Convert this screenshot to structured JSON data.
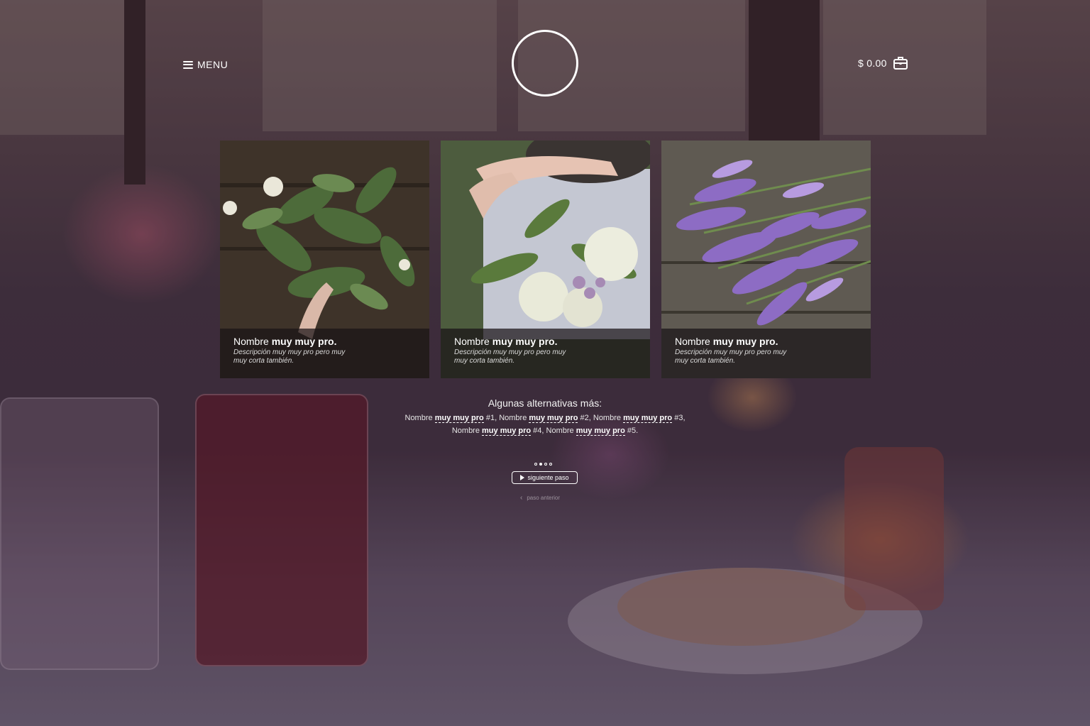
{
  "header": {
    "menu_label": "MENU",
    "cart_amount": "$ 0.00"
  },
  "cards": [
    {
      "name_regular": "Nombre ",
      "name_bold": "muy muy pro.",
      "description": "Descripción muy muy pro pero muy muy corta también.",
      "image": "green-foliage-bouquet"
    },
    {
      "name_regular": "Nombre ",
      "name_bold": "muy muy pro.",
      "description": "Descripción muy muy pro pero muy muy corta también.",
      "image": "bridal-roses-bouquet"
    },
    {
      "name_regular": "Nombre ",
      "name_bold": "muy muy pro.",
      "description": "Descripción muy muy pro pero muy muy corta también.",
      "image": "lavender-bunch"
    }
  ],
  "alternatives": {
    "title": "Algunas alternativas más:",
    "items": [
      {
        "prefix": "Nombre ",
        "bold": "muy muy pro",
        "suffix": " #1"
      },
      {
        "prefix": "Nombre ",
        "bold": "muy muy pro",
        "suffix": " #2"
      },
      {
        "prefix": "Nombre ",
        "bold": "muy muy pro",
        "suffix": " #3"
      },
      {
        "prefix": "Nombre ",
        "bold": "muy muy pro",
        "suffix": " #4"
      },
      {
        "prefix": "Nombre ",
        "bold": "muy muy pro",
        "suffix": " #5"
      }
    ],
    "sep1": ", ",
    "sep2": ", ",
    "sep3": ",",
    "sep4": ", ",
    "end": "."
  },
  "pagination": {
    "total": 4,
    "active_index": 1
  },
  "buttons": {
    "next_label": "siguiente paso",
    "prev_label": "paso anterior"
  },
  "colors": {
    "overlay": "#46284640",
    "caption_bg": "#191416",
    "text": "#ffffff"
  },
  "icons": {
    "menu": "hamburger-icon",
    "cart": "briefcase-icon",
    "next": "play-icon",
    "prev": "chevron-left-icon"
  }
}
